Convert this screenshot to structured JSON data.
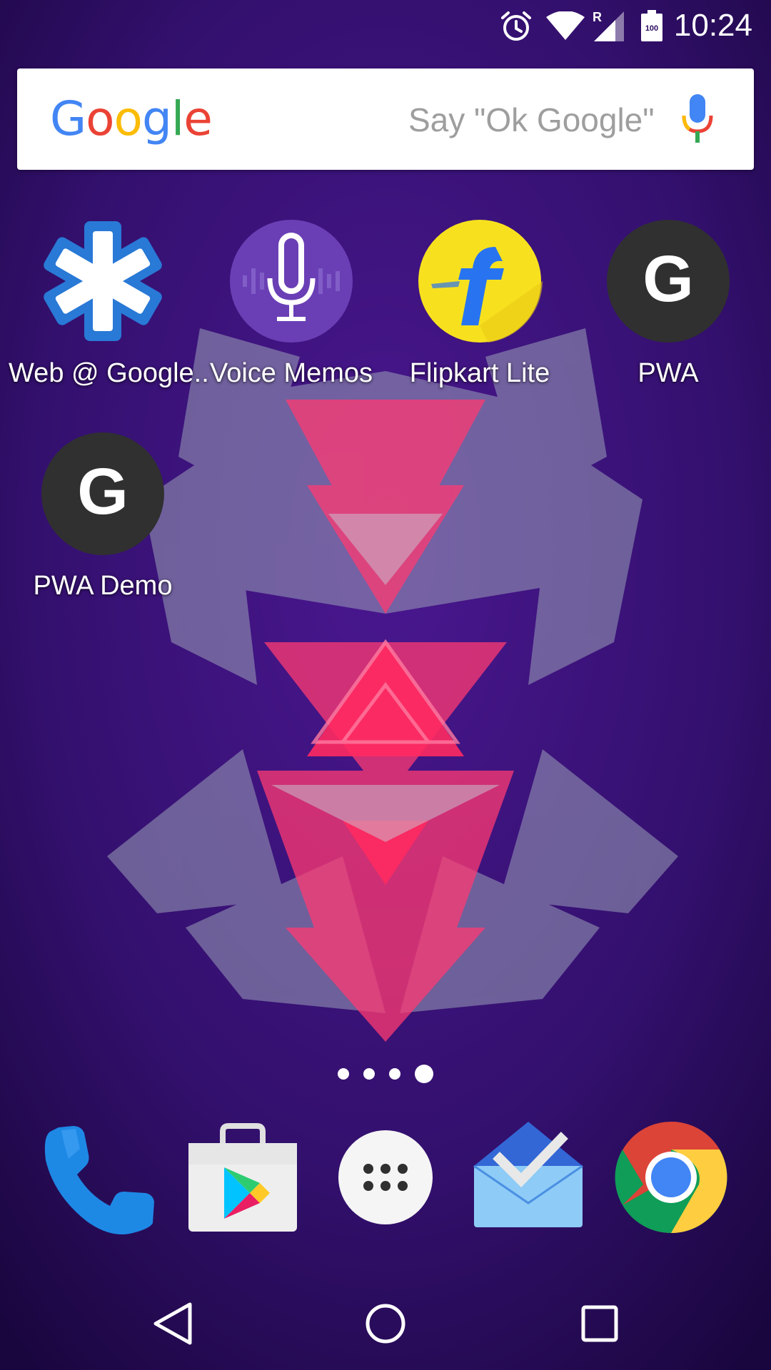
{
  "status_bar": {
    "time": "10:24",
    "battery_level": "100",
    "network_indicator": "R",
    "icons": [
      "alarm-icon",
      "wifi-icon",
      "cell-signal-icon",
      "battery-icon"
    ]
  },
  "search": {
    "logo_text": "Google",
    "placeholder": "Say \"Ok Google\"",
    "logo_colors": [
      "#4285F4",
      "#EA4335",
      "#FBBC05",
      "#4285F4",
      "#34A853",
      "#EA4335"
    ]
  },
  "apps": [
    {
      "label": "Web @ Google..",
      "icon": "asterisk-icon",
      "color": "#2979d6"
    },
    {
      "label": "Voice Memos",
      "icon": "microphone-icon",
      "color": "#6a3fb5"
    },
    {
      "label": "Flipkart Lite",
      "icon": "flipkart-icon",
      "color": "#f7e11f"
    },
    {
      "label": "PWA",
      "icon": "g-letter-icon",
      "color": "#303030"
    },
    {
      "label": "PWA Demo",
      "icon": "g-letter-icon",
      "color": "#303030"
    }
  ],
  "page_indicator": {
    "pages": 4,
    "current": 4
  },
  "dock": [
    {
      "name": "Phone",
      "icon": "phone-icon"
    },
    {
      "name": "Play Store",
      "icon": "play-store-icon"
    },
    {
      "name": "App Drawer",
      "icon": "app-drawer-icon"
    },
    {
      "name": "Inbox",
      "icon": "inbox-icon"
    },
    {
      "name": "Chrome",
      "icon": "chrome-icon"
    }
  ],
  "nav": [
    "back-icon",
    "home-icon",
    "recents-icon"
  ],
  "colors": {
    "wallpaper_base": "#2a0a5e",
    "wallpaper_accent": "#ff2f6e"
  }
}
